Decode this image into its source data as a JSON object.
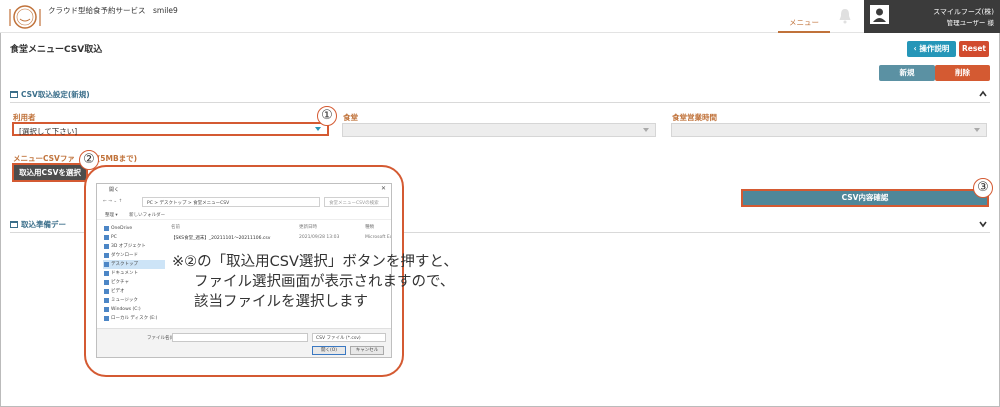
{
  "header": {
    "app_title": "クラウド型給食予約サービス　smile9",
    "menu_tab": "メニュー",
    "user_name": "スマイルフーズ(株)",
    "user_role": "管理ユーザー 様"
  },
  "page": {
    "title": "食堂メニューCSV取込",
    "help_button": "操作説明",
    "reset_button": "Reset",
    "new_button": "新規",
    "delete_button": "削除"
  },
  "section1": {
    "title": "CSV取込設定(新規)",
    "user_label": "利用者",
    "user_value": "[選択して下さい]",
    "canteen_label": "食堂",
    "hours_label": "食堂営業時間",
    "csv_label": "メニューCSVファ",
    "csv_label_suffix": "(5MBまで)",
    "upload_button": "取込用CSVを選択",
    "confirm_button": "CSV内容確認"
  },
  "section2": {
    "title": "取込準備デー"
  },
  "badges": [
    "①",
    "②",
    "③"
  ],
  "dialog": {
    "title": "開く",
    "breadcrumb": "PC  >  デスクトップ  >  食堂メニューCSV",
    "search_placeholder": "食堂メニューCSVの検索",
    "toolbar_organize": "整理 ▾",
    "toolbar_new_folder": "新しいフォルダー",
    "sidebar": [
      "OneDrive",
      "PC",
      "3D オブジェクト",
      "ダウンロード",
      "デスクトップ",
      "ドキュメント",
      "ピクチャ",
      "ビデオ",
      "ミュージック",
      "Windows (C:)",
      "ローカル ディスク (E:)"
    ],
    "col_name": "名前",
    "col_date": "更新日時",
    "col_type": "種類",
    "file_name": "【SKS食堂_週末】_20211101〜20211106.csv",
    "file_date": "2021/09/28 13:03",
    "file_type": "Microsoft Ex",
    "filename_label": "ファイル名(N):",
    "filetype_value": "CSV ファイル (*.csv)",
    "open_button": "開く(O)",
    "cancel_button": "キャンセル"
  },
  "note": {
    "line1": "※②の「取込用CSV選択」ボタンを押すと、",
    "line2": "ファイル選択画面が表示されますので、",
    "line3": "該当ファイルを選択します"
  },
  "colors": {
    "accent_orange": "#c0723a",
    "highlight_red": "#d45a32",
    "teal": "#4f8799",
    "help_blue": "#2596b8"
  }
}
